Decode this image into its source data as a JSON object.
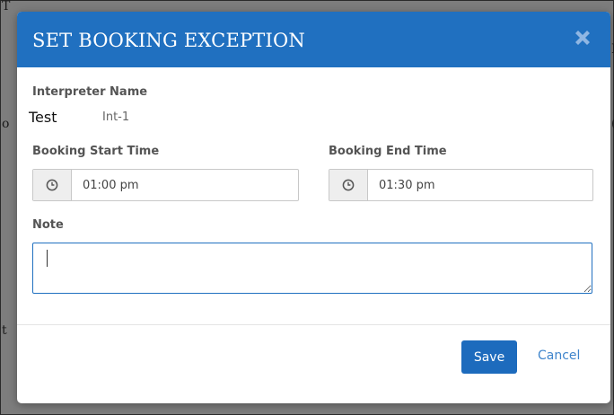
{
  "background": {
    "fragments": [
      "T",
      "I",
      "o",
      "t",
      "("
    ]
  },
  "dialog": {
    "title": "SET BOOKING EXCEPTION",
    "close_icon": "close-x-icon",
    "header_color": "#2070c0",
    "interpreter": {
      "label": "Interpreter Name",
      "first_name": "Test",
      "last_name": "Int-1"
    },
    "start_time": {
      "label": "Booking Start Time",
      "value": "01:00 pm",
      "icon": "clock-icon"
    },
    "end_time": {
      "label": "Booking End Time",
      "value": "01:30 pm",
      "icon": "clock-icon"
    },
    "note": {
      "label": "Note",
      "value": ""
    },
    "buttons": {
      "save_label": "Save",
      "cancel_label": "Cancel"
    }
  }
}
